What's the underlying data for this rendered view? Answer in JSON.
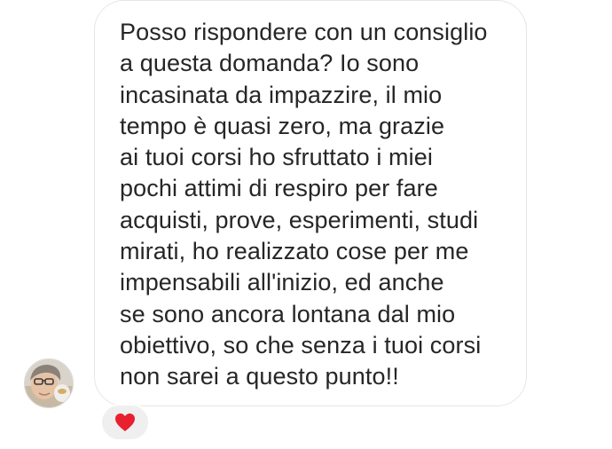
{
  "message": {
    "text": "Posso rispondere con un consiglio\na questa domanda? Io sono\nincasinata da impazzire, il mio\ntempo è quasi zero, ma grazie\nai tuoi corsi ho sfruttato i miei\npochi attimi di respiro per fare\nacquisti, prove, esperimenti, studi\nmirati, ho realizzato cose per me\nimpensabili all'inizio, ed anche\nse sono ancora lontana dal mio\nobiettivo, so che senza i tuoi corsi\nnon sarei a questo punto!!",
    "reaction_icon": "heart-icon",
    "bubble_color": "#ffffff",
    "reaction_color": "#e8202f"
  },
  "sender": {
    "avatar_icon": "avatar"
  }
}
